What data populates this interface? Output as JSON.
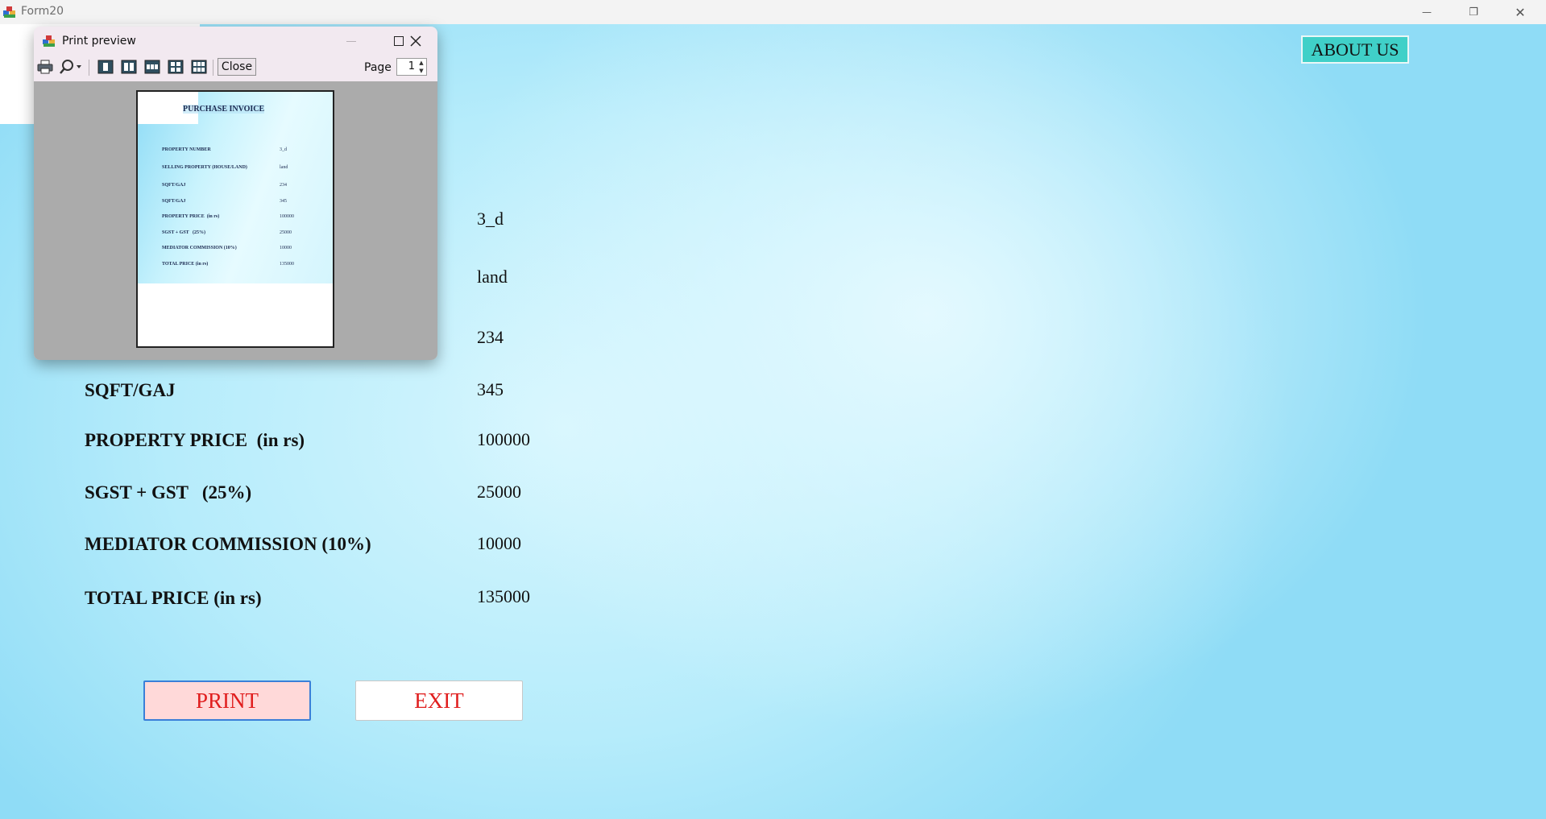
{
  "window": {
    "title": "Form20",
    "minimize": "—",
    "restore": "❐",
    "close": "✕"
  },
  "about_label": "ABOUT US",
  "fields": [
    {
      "label": "PROPERTY NUMBER",
      "value": "3_d"
    },
    {
      "label": "SELLING PROPERTY (HOUSE/LAND)",
      "value": "land"
    },
    {
      "label": "SQFT/GAJ",
      "value": "234"
    },
    {
      "label": "SQFT/GAJ",
      "value": "345"
    },
    {
      "label": "PROPERTY PRICE  (in rs)",
      "value": "100000"
    },
    {
      "label": "SGST + GST   (25%)",
      "value": "25000"
    },
    {
      "label": "MEDIATOR COMMISSION (10%)",
      "value": "10000"
    },
    {
      "label": "TOTAL PRICE (in rs)",
      "value": "135000"
    }
  ],
  "buttons": {
    "print": "PRINT",
    "exit": "EXIT"
  },
  "print_preview": {
    "title": "Print preview",
    "close_label": "Close",
    "page_label": "Page",
    "page_value": "1",
    "page_heading": "PURCHASE INVOICE",
    "toolbar_icons": [
      "printer-icon",
      "zoom-icon",
      "one-page-icon",
      "two-pages-icon",
      "three-pages-icon",
      "four-pages-icon",
      "six-pages-icon"
    ]
  },
  "colors": {
    "about_bg": "#40d0c8",
    "print_bg": "#ffd9d9",
    "button_text": "#e01e1e",
    "print_border": "#3a7fd8"
  }
}
